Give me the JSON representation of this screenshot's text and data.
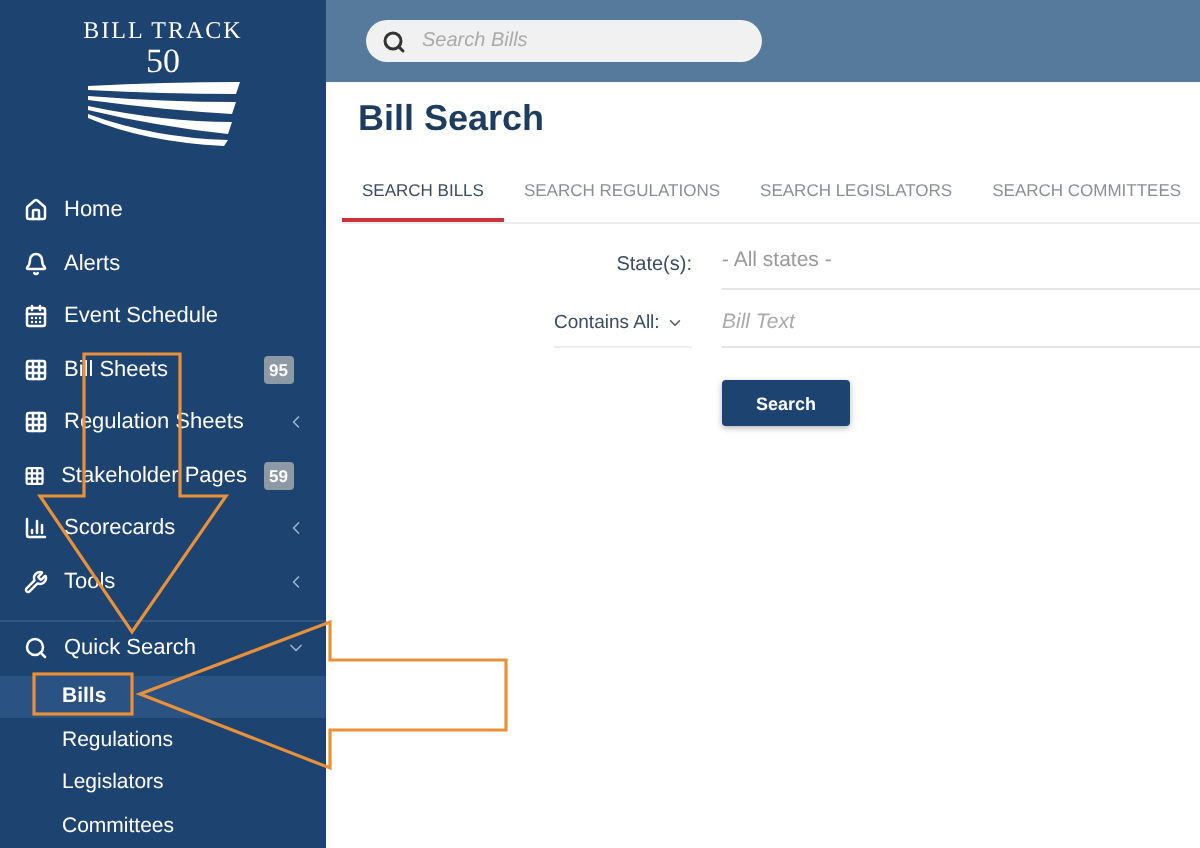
{
  "logo": {
    "line_1": "BILL TRACK",
    "line_2": "50"
  },
  "sidebar": {
    "items": [
      {
        "label": "Home"
      },
      {
        "label": "Alerts"
      },
      {
        "label": "Event Schedule"
      },
      {
        "label": "Bill Sheets",
        "badge": "95"
      },
      {
        "label": "Regulation Sheets",
        "expanded": false
      },
      {
        "label": "Stakeholder Pages",
        "badge": "59"
      },
      {
        "label": "Scorecards",
        "expanded": false
      },
      {
        "label": "Tools",
        "expanded": false
      },
      {
        "label": "Quick Search",
        "expanded": true,
        "children": [
          {
            "label": "Bills",
            "selected": true
          },
          {
            "label": "Regulations",
            "selected": false
          },
          {
            "label": "Legislators",
            "selected": false
          },
          {
            "label": "Committees",
            "selected": false
          }
        ]
      }
    ]
  },
  "search": {
    "placeholder": "Search Bills"
  },
  "page_title": "Bill Search",
  "tabs": [
    {
      "label": "SEARCH BILLS",
      "selected": true
    },
    {
      "label": "SEARCH REGULATIONS",
      "selected": false
    },
    {
      "label": "SEARCH LEGISLATORS",
      "selected": false
    },
    {
      "label": "SEARCH COMMITTEES",
      "selected": false
    }
  ],
  "form": {
    "state_label": "State(s):",
    "state_value": "- All states -",
    "mode_label": "Contains All:",
    "text_placeholder": "Bill Text",
    "button": "Search"
  },
  "annotations": [
    {
      "kind": "down-arrow"
    },
    {
      "kind": "left-arrow"
    },
    {
      "kind": "frame"
    }
  ]
}
